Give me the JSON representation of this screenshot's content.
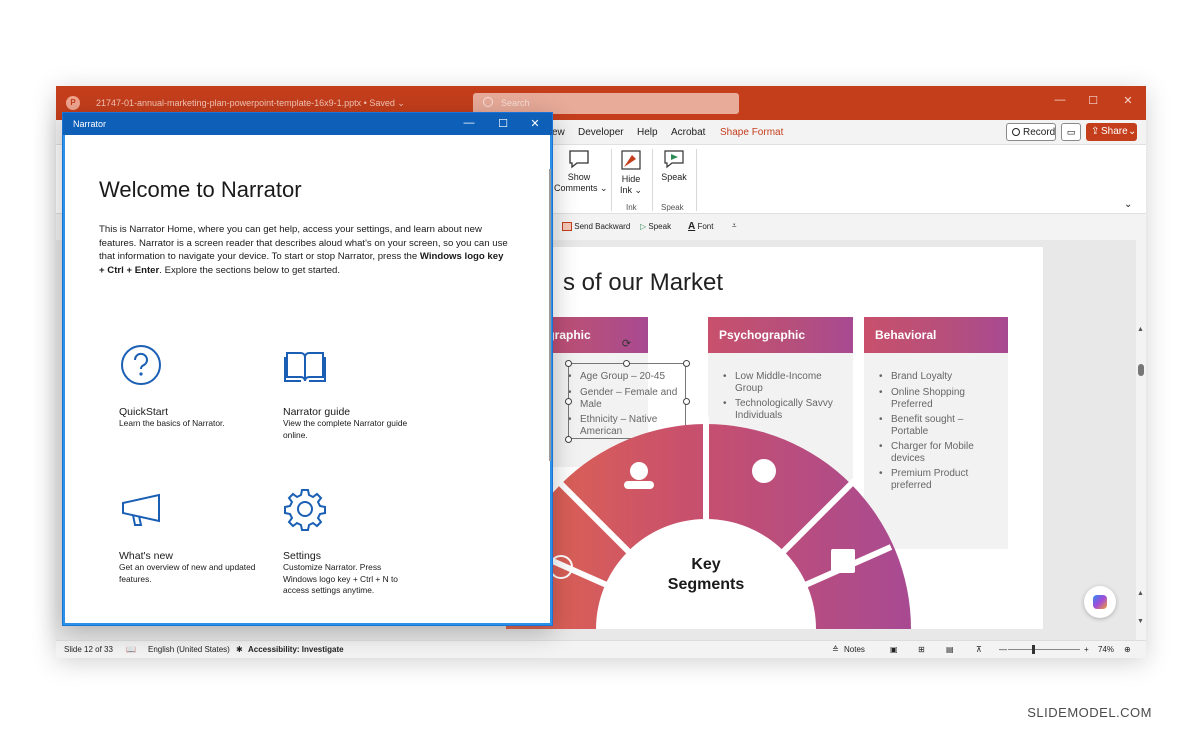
{
  "titlebar": {
    "filename": "21747-01-annual-marketing-plan-powerpoint-template-16x9-1.pptx",
    "saved": "Saved",
    "search_placeholder": "Search"
  },
  "ribbon_tabs": [
    {
      "label": "ew"
    },
    {
      "label": "Developer"
    },
    {
      "label": "Help"
    },
    {
      "label": "Acrobat"
    },
    {
      "label": "Shape Format",
      "active": true
    }
  ],
  "ribbon_right": {
    "record": "Record",
    "share": "Share"
  },
  "ribbon": {
    "show_comments_1": "Show",
    "show_comments_2": "Comments",
    "hide_ink_1": "Hide",
    "hide_ink_2": "Ink",
    "speak": "Speak",
    "group_ink": "Ink",
    "group_speak": "Speak"
  },
  "qat": {
    "send_backward": "Send Backward",
    "speak": "Speak",
    "font": "Font"
  },
  "slide": {
    "title": "s of our Market",
    "segments": [
      {
        "name": "Demographic",
        "items": [
          "Age Group – 20-45",
          "Gender – Female and",
          "Male",
          "Ethnicity – Native",
          "American"
        ]
      },
      {
        "name": "Psychographic",
        "items": [
          "Low Middle-Income",
          "Group",
          "Technologically Savvy",
          "Individuals"
        ]
      },
      {
        "name": "Behavioral",
        "items": [
          "Brand Loyalty",
          "Online Shopping",
          "Preferred",
          "Benefit sought –",
          "Portable",
          "Charger for Mobile",
          "devices",
          "Premium Product",
          "preferred"
        ]
      }
    ],
    "center_1": "Key",
    "center_2": "Segments",
    "gradient_colors": [
      "#e2674d",
      "#c8506c",
      "#a84a92"
    ]
  },
  "statusbar": {
    "slide": "Slide 12 of 33",
    "language": "English (United States)",
    "accessibility": "Accessibility: Investigate",
    "notes": "Notes",
    "zoom": "74%"
  },
  "narrator": {
    "title": "Narrator",
    "heading": "Welcome to Narrator",
    "intro": "This is Narrator Home, where you can get help, access your settings, and learn about new features. Narrator is a screen reader that describes aloud what's on your screen, so you can use that information to navigate your device. To start or stop Narrator, press the ",
    "intro_bold": "Windows logo key + Ctrl + Enter",
    "intro_end": ". Explore the sections below to get started.",
    "items": [
      {
        "title": "QuickStart",
        "desc": "Learn the basics of Narrator."
      },
      {
        "title": "Narrator guide",
        "desc": "View the complete Narrator guide online."
      },
      {
        "title": "What's new",
        "desc": "Get an overview of new and updated features."
      },
      {
        "title": "Settings",
        "desc": "Customize Narrator. Press Windows logo key + Ctrl + N to access settings anytime."
      }
    ],
    "accent": "#1a5fb4"
  },
  "watermark": "SLIDEMODEL.COM"
}
